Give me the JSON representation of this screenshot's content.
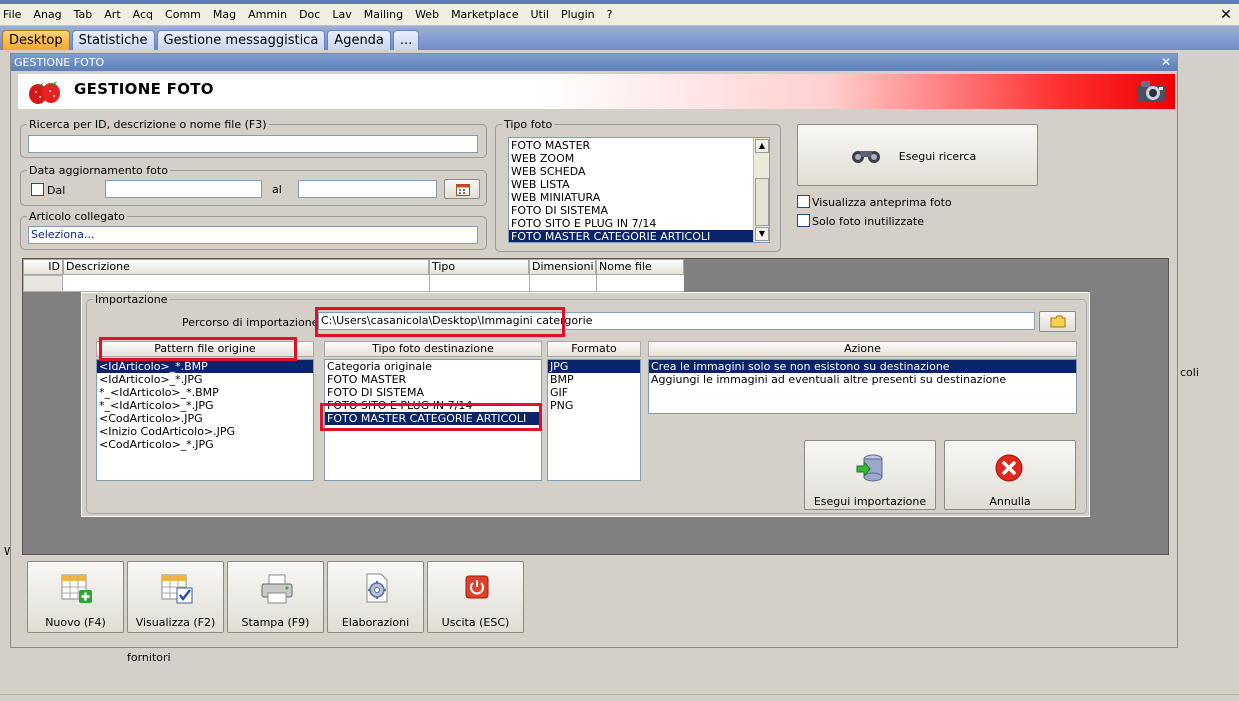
{
  "menubar": {
    "items": [
      "File",
      "Anag",
      "Tab",
      "Art",
      "Acq",
      "Comm",
      "Mag",
      "Ammin",
      "Doc",
      "Lav",
      "Mailing",
      "Web",
      "Marketplace",
      "Util",
      "Plugin",
      "?"
    ]
  },
  "tabs": [
    {
      "label": "Desktop",
      "active": true
    },
    {
      "label": "Statistiche",
      "active": false
    },
    {
      "label": "Gestione messaggistica",
      "active": false
    },
    {
      "label": "Agenda",
      "active": false
    },
    {
      "label": "...",
      "active": false
    }
  ],
  "window": {
    "title": "GESTIONE FOTO",
    "header_title": "GESTIONE FOTO"
  },
  "search": {
    "legend": "Ricerca per ID, descrizione o nome file (F3)",
    "value": ""
  },
  "date_filter": {
    "legend": "Data aggiornamento foto",
    "from_label": "Dal",
    "to_label": "al",
    "from_value": "",
    "to_value": ""
  },
  "linked_article": {
    "legend": "Articolo collegato",
    "value": "Seleziona..."
  },
  "photo_type": {
    "legend": "Tipo foto",
    "items": [
      "FOTO MASTER",
      "WEB ZOOM",
      "WEB SCHEDA",
      "WEB LISTA",
      "WEB MINIATURA",
      "FOTO DI SISTEMA",
      "FOTO SITO E PLUG IN 7/14",
      "FOTO MASTER CATEGORIE ARTICOLI"
    ],
    "selected_index": 7
  },
  "search_button": {
    "label": "Esegui ricerca"
  },
  "options": {
    "preview_label": "Visualizza anteprima foto",
    "unused_label": "Solo foto inutilizzate"
  },
  "grid": {
    "columns": [
      "ID",
      "Descrizione",
      "Tipo",
      "Dimensioni",
      "Nome file"
    ]
  },
  "import": {
    "legend": "Importazione",
    "path_label": "Percorso di importazione :",
    "path_value": "C:\\Users\\casanicola\\Desktop\\Immagini catergorie",
    "pattern": {
      "header": "Pattern file origine",
      "items": [
        "<IdArticolo>_*.BMP",
        "<IdArticolo>_*.JPG",
        "*_<IdArticolo>_*.BMP",
        "*_<IdArticolo>_*.JPG",
        "<CodArticolo>.JPG",
        "<Inizio CodArticolo>.JPG",
        "<CodArticolo>_*.JPG"
      ],
      "selected_index": 0
    },
    "dest_type": {
      "header": "Tipo foto destinazione",
      "items": [
        "Categoria originale",
        "FOTO MASTER",
        "FOTO DI SISTEMA",
        "FOTO SITO E PLUG IN 7/14",
        "FOTO MASTER CATEGORIE ARTICOLI"
      ],
      "selected_index": 4
    },
    "format": {
      "header": "Formato",
      "items": [
        "JPG",
        "BMP",
        "GIF",
        "PNG"
      ],
      "selected_index": 0
    },
    "action": {
      "header": "Azione",
      "items": [
        "Crea le immagini solo se non esistono su destinazione",
        "Aggiungi le immagini ad eventuali altre presenti su destinazione"
      ],
      "selected_index": 0
    },
    "run_label": "Esegui importazione",
    "cancel_label": "Annulla"
  },
  "toolbar": {
    "new_label": "Nuovo (F4)",
    "view_label": "Visualizza (F2)",
    "print_label": "Stampa (F9)",
    "process_label": "Elaborazioni",
    "exit_label": "Uscita (ESC)"
  },
  "background": {
    "suppliers_label": "fornitori",
    "right_fragment": "coli",
    "left_fragment": "W"
  },
  "colors": {
    "selection": "#0a246a",
    "highlight_box": "#e0102a",
    "active_tab": "#f4a62c"
  }
}
